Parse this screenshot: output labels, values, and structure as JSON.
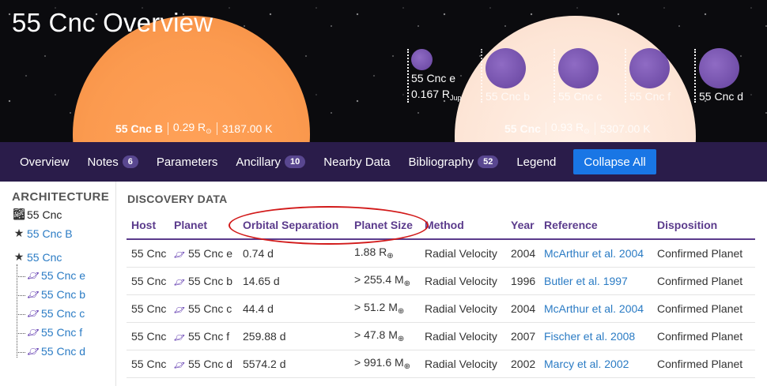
{
  "hero": {
    "title": "55 Cnc Overview",
    "star_a": {
      "name": "55 Cnc B",
      "radius_value": "0.29 R",
      "radius_sub": "⊙",
      "temperature": "3187.00 K"
    },
    "star_b": {
      "name": "55 Cnc",
      "radius_value": "0.93 R",
      "radius_sub": "⊙",
      "temperature": "5307.00 K"
    },
    "planets": [
      {
        "name": "55 Cnc e",
        "size_value": "0.167 R",
        "size_sub": "Jup"
      },
      {
        "name": "55 Cnc b"
      },
      {
        "name": "55 Cnc c"
      },
      {
        "name": "55 Cnc f"
      },
      {
        "name": "55 Cnc d"
      }
    ]
  },
  "nav": {
    "items": [
      {
        "label": "Overview"
      },
      {
        "label": "Notes",
        "badge": "6"
      },
      {
        "label": "Parameters"
      },
      {
        "label": "Ancillary",
        "badge": "10"
      },
      {
        "label": "Nearby Data"
      },
      {
        "label": "Bibliography",
        "badge": "52"
      },
      {
        "label": "Legend"
      }
    ],
    "collapse_label": "Collapse All"
  },
  "sidebar": {
    "title": "ARCHITECTURE",
    "system": "55 Cnc",
    "star_b": "55 Cnc B",
    "star_a": "55 Cnc",
    "planets": [
      "55 Cnc e",
      "55 Cnc b",
      "55 Cnc c",
      "55 Cnc f",
      "55 Cnc d"
    ]
  },
  "discovery": {
    "title": "DISCOVERY DATA",
    "columns": [
      "Host",
      "Planet",
      "Orbital Separation",
      "Planet Size",
      "Method",
      "Year",
      "Reference",
      "Disposition"
    ],
    "rows": [
      {
        "host": "55 Cnc",
        "planet": "55 Cnc e",
        "separation": "0.74 d",
        "size": "1.88 R",
        "size_sub": "⊕",
        "method": "Radial Velocity",
        "year": "2004",
        "reference": "McArthur et al. 2004",
        "disposition": "Confirmed Planet"
      },
      {
        "host": "55 Cnc",
        "planet": "55 Cnc b",
        "separation": "14.65 d",
        "size": "> 255.4 M",
        "size_sub": "⊕",
        "method": "Radial Velocity",
        "year": "1996",
        "reference": "Butler et al. 1997",
        "disposition": "Confirmed Planet"
      },
      {
        "host": "55 Cnc",
        "planet": "55 Cnc c",
        "separation": "44.4 d",
        "size": "> 51.2 M",
        "size_sub": "⊕",
        "method": "Radial Velocity",
        "year": "2004",
        "reference": "McArthur et al. 2004",
        "disposition": "Confirmed Planet"
      },
      {
        "host": "55 Cnc",
        "planet": "55 Cnc f",
        "separation": "259.88 d",
        "size": "> 47.8 M",
        "size_sub": "⊕",
        "method": "Radial Velocity",
        "year": "2007",
        "reference": "Fischer et al. 2008",
        "disposition": "Confirmed Planet"
      },
      {
        "host": "55 Cnc",
        "planet": "55 Cnc d",
        "separation": "5574.2 d",
        "size": "> 991.6 M",
        "size_sub": "⊕",
        "method": "Radial Velocity",
        "year": "2002",
        "reference": "Marcy et al. 2002",
        "disposition": "Confirmed Planet"
      }
    ]
  },
  "colors": {
    "nav_bg": "#2a1c4a",
    "accent_purple": "#5b3b8c",
    "button_blue": "#1976e5",
    "link_blue": "#2a7bc4",
    "star_b_orange": "#fb9a4f",
    "star_a_peach": "#fde5d6",
    "planet_purple": "#7653ad",
    "highlight_red": "#d21a1a"
  },
  "icons": {
    "system": "galaxy-icon",
    "star": "star-icon",
    "planet": "planet-icon"
  }
}
